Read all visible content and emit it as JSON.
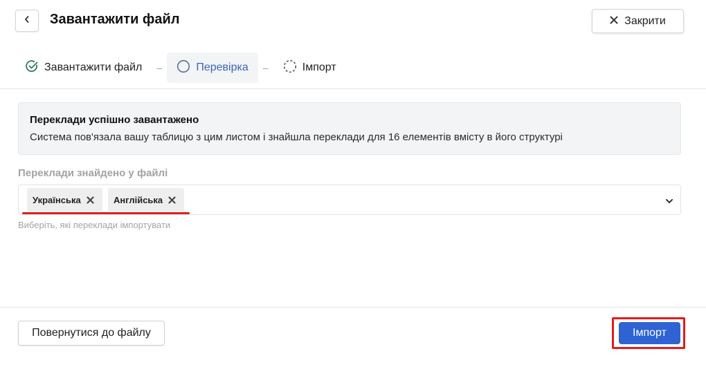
{
  "header": {
    "title": "Завантажити файл",
    "close_label": "Закрити"
  },
  "stepper": {
    "steps": [
      {
        "label": "Завантажити файл",
        "state": "done"
      },
      {
        "label": "Перевірка",
        "state": "active"
      },
      {
        "label": "Імпорт",
        "state": "pending"
      }
    ],
    "separator": "–"
  },
  "alert": {
    "title": "Переклади успішно завантажено",
    "text": "Система пов'язала вашу таблицю з цим листом і знайшла переклади для 16 елементів вмісту в його структурі"
  },
  "translations_field": {
    "label": "Переклади знайдено у файлі",
    "chips": [
      "Українська",
      "Англійська"
    ],
    "helper": "Виберіть, які переклади імпортувати"
  },
  "footer": {
    "back_label": "Повернутися до файлу",
    "import_label": "Імпорт"
  },
  "colors": {
    "accent": "#2f63d4",
    "active_step": "#3d63b8",
    "done_check": "#2e7d5b",
    "highlight": "#e31b1b"
  }
}
